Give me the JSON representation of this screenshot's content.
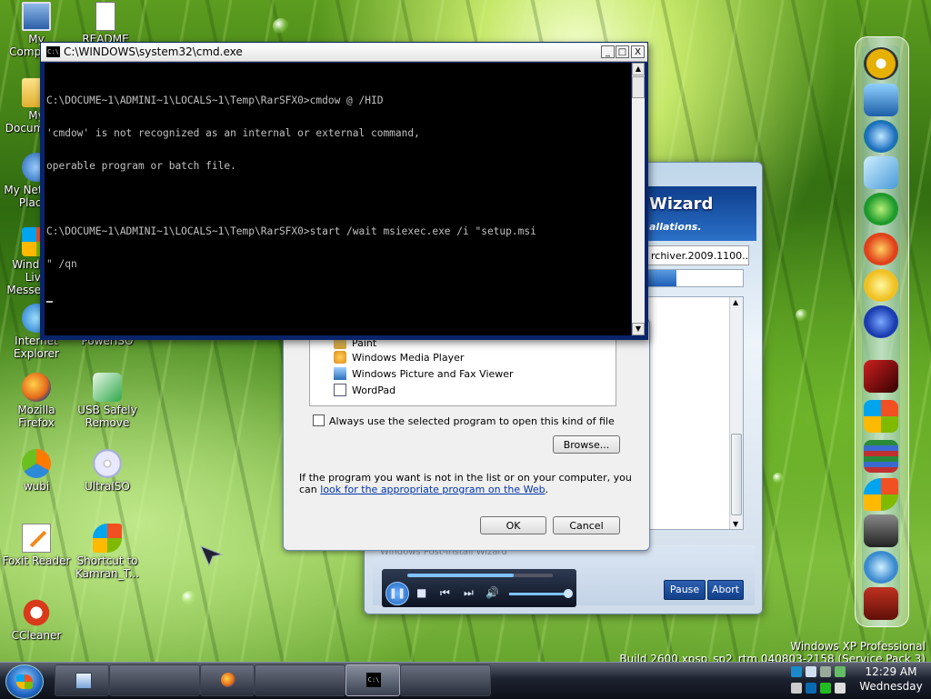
{
  "desktop": {
    "icons": [
      {
        "label": "My Computer",
        "icon": "computer-icon"
      },
      {
        "label": "README",
        "icon": "document-icon"
      },
      {
        "label": "My Documents",
        "icon": "folder-icon"
      },
      {
        "label": "My Network Places",
        "icon": "network-icon"
      },
      {
        "label": "Windows Live Messenger",
        "icon": "windows-live-icon"
      },
      {
        "label": "Internet Explorer",
        "icon": "internet-explorer-icon"
      },
      {
        "label": "PowerISO",
        "icon": "poweriso-icon"
      },
      {
        "label": "Mozilla Firefox",
        "icon": "firefox-icon"
      },
      {
        "label": "USB Safely Remove",
        "icon": "usb-icon"
      },
      {
        "label": "wubi",
        "icon": "wubi-icon"
      },
      {
        "label": "UltraISO",
        "icon": "cd-icon"
      },
      {
        "label": "Foxit Reader",
        "icon": "foxit-icon"
      },
      {
        "label": "Shortcut to Kamran_T...",
        "icon": "windows-xp-icon"
      },
      {
        "label": "CCleaner",
        "icon": "ccleaner-icon"
      }
    ],
    "os_edition": "Windows XP Professional",
    "os_build": "Build 2600.xpsp_sp2_rtm.040803-2158 (Service Pack 3)"
  },
  "cmd_window": {
    "title": "C:\\WINDOWS\\system32\\cmd.exe",
    "lines": [
      "C:\\DOCUME~1\\ADMINI~1\\LOCALS~1\\Temp\\RarSFX0>cmdow @ /HID",
      "'cmdow' is not recognized as an internal or external command,",
      "operable program or batch file.",
      "",
      "C:\\DOCUME~1\\ADMINI~1\\LOCALS~1\\Temp\\RarSFX0>start /wait msiexec.exe /i \"setup.msi",
      "\" /qn"
    ],
    "minimize": "_",
    "maximize": "□",
    "close": "X"
  },
  "wizard": {
    "title_fragment": "Wizard",
    "subtitle_fragment": "allations.",
    "field_value": "rchiver.2009.1100....",
    "progress_percent": 30,
    "footer_label": "Windows Post-Install Wizard",
    "pause_label": "Pause",
    "abort_label": "Abort"
  },
  "player": {
    "seek_percent": 73,
    "volume_percent": 100
  },
  "open_with": {
    "partial_item": "Paint",
    "items": [
      {
        "label": "Windows Media Player",
        "icon": "media-player-icon"
      },
      {
        "label": "Windows Picture and Fax Viewer",
        "icon": "picture-viewer-icon"
      },
      {
        "label": "WordPad",
        "icon": "wordpad-icon"
      }
    ],
    "always_use_label": "Always use the selected program to open this kind of file",
    "browse_label": "Browse...",
    "info_text": "If the program you want is not in the list or on your computer, you can ",
    "info_link": "look for the appropriate program on the Web",
    "info_end": ".",
    "ok_label": "OK",
    "cancel_label": "Cancel"
  },
  "dock": {
    "items": [
      "chat-icon",
      "monitor-icon",
      "globe-icon",
      "media-icon",
      "internet-explorer-icon",
      "media-player-icon",
      "smiley-icon",
      "messenger-icon",
      "game-icon",
      "windows-flag-icon",
      "books-icon",
      "windows-xp-icon",
      "network-icon",
      "tools-icon",
      "robot-icon"
    ]
  },
  "taskbar": {
    "clock_time": "12:29 AM",
    "clock_day": "Wednesday",
    "cmd_button_label": "C:\\"
  }
}
